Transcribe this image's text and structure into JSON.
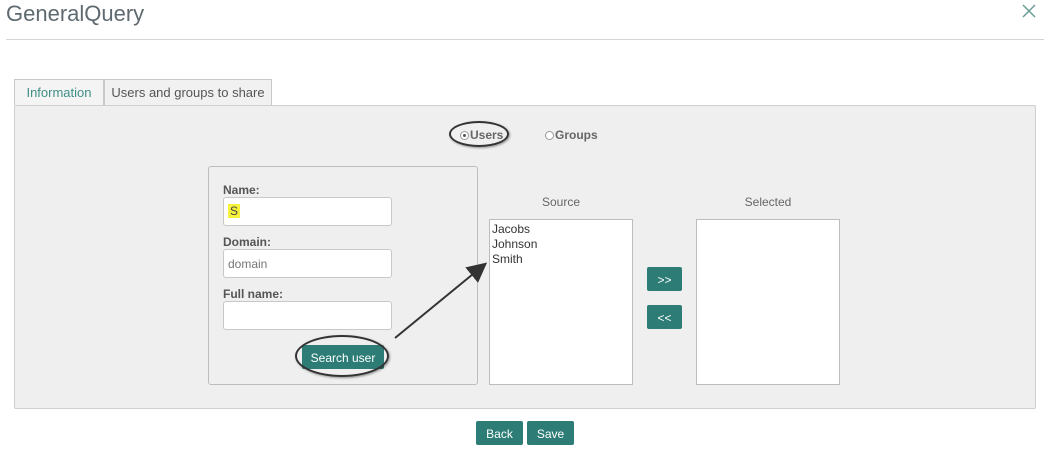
{
  "window": {
    "title": "GeneralQuery"
  },
  "tabs": [
    {
      "label": "Information"
    },
    {
      "label": "Users and groups to share"
    }
  ],
  "mode": {
    "users_label": "Users",
    "groups_label": "Groups",
    "selected": "Users"
  },
  "form": {
    "name_label": "Name:",
    "name_value": "S",
    "domain_label": "Domain:",
    "domain_placeholder": "domain",
    "fullname_label": "Full name:",
    "fullname_value": "",
    "search_button": "Search user"
  },
  "source": {
    "title": "Source",
    "items": [
      "Jacobs",
      "Johnson",
      "Smith"
    ]
  },
  "selected": {
    "title": "Selected",
    "items": []
  },
  "transfer": {
    "add_label": ">>",
    "remove_label": "<<"
  },
  "footer": {
    "back_label": "Back",
    "save_label": "Save"
  },
  "colors": {
    "accent": "#2d7d76",
    "highlight": "#f6f13a",
    "tab_active_text": "#3f8e86"
  }
}
